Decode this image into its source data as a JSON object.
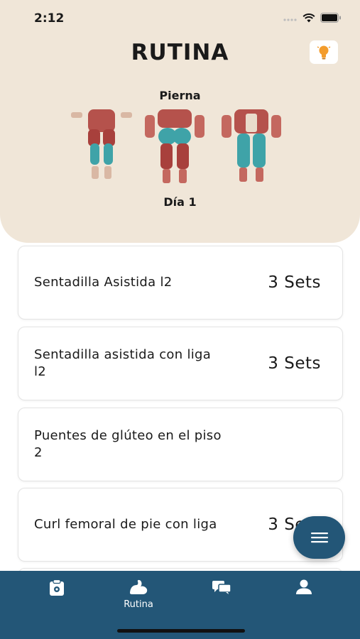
{
  "status_bar": {
    "time": "2:12"
  },
  "header": {
    "title": "RUTINA",
    "muscle_group": "Pierna",
    "day": "Día 1",
    "tip_icon": "lightbulb-icon"
  },
  "exercises": [
    {
      "name": "Sentadilla Asistida l2",
      "sets": "3 Sets"
    },
    {
      "name": "Sentadilla asistida con liga l2",
      "sets": "3 Sets"
    },
    {
      "name": "Puentes de glúteo en el piso  2",
      "sets": ""
    },
    {
      "name": "Curl femoral de pie con liga",
      "sets": "3 Sets"
    }
  ],
  "tabbar": {
    "tabs": [
      {
        "icon": "clipboard-icon",
        "label": ""
      },
      {
        "icon": "flexed-arm-icon",
        "label": "Rutina"
      },
      {
        "icon": "chat-icon",
        "label": ""
      },
      {
        "icon": "person-icon",
        "label": ""
      }
    ],
    "active_tab": "Rutina"
  },
  "colors": {
    "header_bg": "#f0e6d8",
    "primary": "#235677",
    "muscle_highlight": "#3fa3a8",
    "muscle": "#a8403c",
    "tip_bulb": "#f39c2c"
  }
}
